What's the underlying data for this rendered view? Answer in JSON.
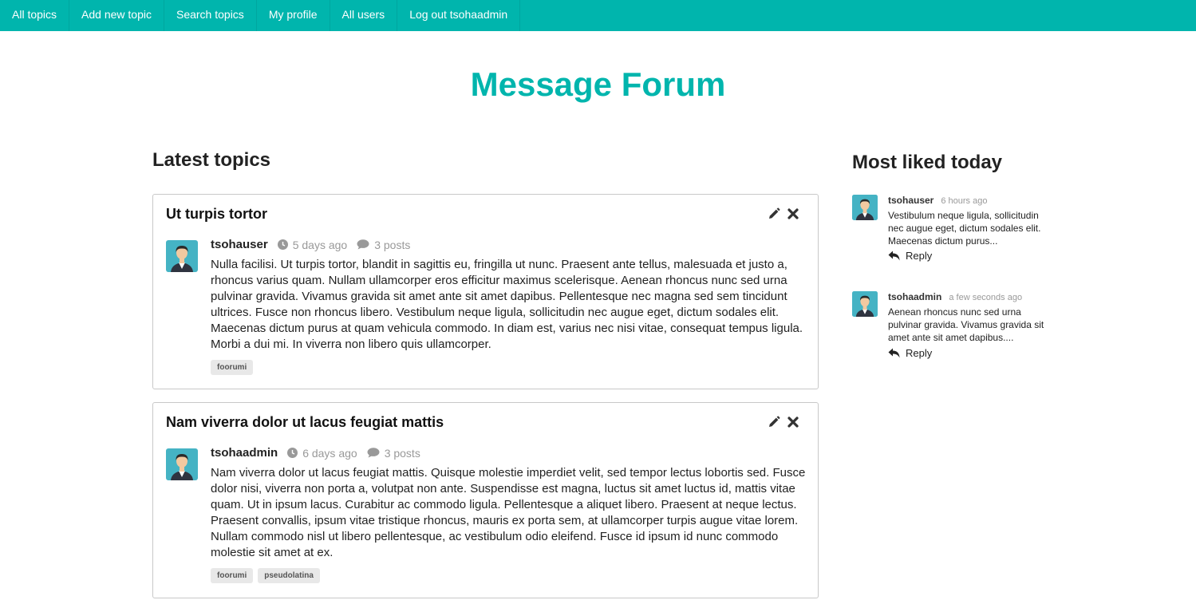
{
  "nav": {
    "items": [
      "All topics",
      "Add new topic",
      "Search topics",
      "My profile",
      "All users",
      "Log out tsohaadmin"
    ]
  },
  "site_title": "Message Forum",
  "latest": {
    "heading": "Latest topics",
    "topics": [
      {
        "title": "Ut turpis tortor",
        "author": "tsohauser",
        "time": "5 days ago",
        "posts": "3 posts",
        "body": "Nulla facilisi. Ut turpis tortor, blandit in sagittis eu, fringilla ut nunc. Praesent ante tellus, malesuada et justo a, rhoncus varius quam. Nullam ullamcorper eros efficitur maximus scelerisque. Aenean rhoncus nunc sed urna pulvinar gravida. Vivamus gravida sit amet ante sit amet dapibus. Pellentesque nec magna sed sem tincidunt ultrices. Fusce non rhoncus libero. Vestibulum neque ligula, sollicitudin nec augue eget, dictum sodales elit. Maecenas dictum purus at quam vehicula commodo. In diam est, varius nec nisi vitae, consequat tempus ligula. Morbi a dui mi. In viverra non libero quis ullamcorper.",
        "tags": [
          "foorumi"
        ]
      },
      {
        "title": "Nam viverra dolor ut lacus feugiat mattis",
        "author": "tsohaadmin",
        "time": "6 days ago",
        "posts": "3 posts",
        "body": "Nam viverra dolor ut lacus feugiat mattis. Quisque molestie imperdiet velit, sed tempor lectus lobortis sed. Fusce dolor nisi, viverra non porta a, volutpat non ante. Suspendisse est magna, luctus sit amet luctus id, mattis vitae quam. Ut in ipsum lacus. Curabitur ac commodo ligula. Pellentesque a aliquet libero. Praesent at neque lectus. Praesent convallis, ipsum vitae tristique rhoncus, mauris ex porta sem, at ullamcorper turpis augue vitae lorem. Nullam commodo nisl ut libero pellentesque, ac vestibulum odio eleifend. Fusce id ipsum id nunc commodo molestie sit amet at ex.",
        "tags": [
          "foorumi",
          "pseudolatina"
        ]
      }
    ]
  },
  "liked": {
    "heading": "Most liked today",
    "items": [
      {
        "author": "tsohauser",
        "time": "6 hours ago",
        "body": "Vestibulum neque ligula, sollicitudin nec augue eget, dictum sodales elit. Maecenas dictum purus...",
        "reply": "Reply"
      },
      {
        "author": "tsohaadmin",
        "time": "a few seconds ago",
        "body": "Aenean rhoncus nunc sed urna pulvinar gravida. Vivamus gravida sit amet ante sit amet dapibus....",
        "reply": "Reply"
      }
    ]
  },
  "colors": {
    "accent": "#00b5ad",
    "muted": "#999999",
    "tag_bg": "#e8e8e8"
  },
  "icons": [
    "pencil-icon",
    "close-icon",
    "clock-icon",
    "comment-icon",
    "reply-icon",
    "avatar-icon"
  ]
}
